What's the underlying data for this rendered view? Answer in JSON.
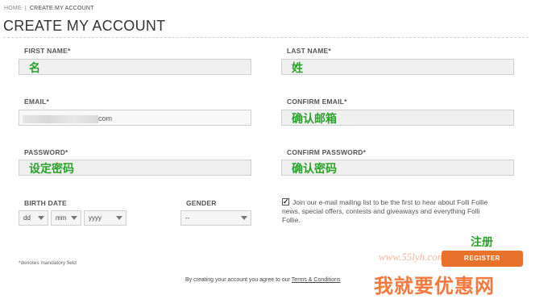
{
  "breadcrumb": {
    "home": "HOME",
    "separator": "|",
    "current": "CREATE MY ACCOUNT"
  },
  "page_title": "CREATE MY ACCOUNT",
  "fields": {
    "first_name": {
      "label": "FIRST NAME*",
      "value": "名"
    },
    "last_name": {
      "label": "LAST NAME*",
      "value": "姓"
    },
    "email": {
      "label": "EMAIL*",
      "value_suffix": "com"
    },
    "confirm_email": {
      "label": "CONFIRM EMAIL*",
      "value": "确认邮箱"
    },
    "password": {
      "label": "PASSWORD*",
      "value": "设定密码"
    },
    "confirm_password": {
      "label": "CONFIRM PASSWORD*",
      "value": "确认密码"
    }
  },
  "birth_date": {
    "label": "BIRTH DATE",
    "day": "dd",
    "month": "mm",
    "year": "yyyy"
  },
  "gender": {
    "label": "GENDER",
    "value": "--"
  },
  "mailing": {
    "checked": true,
    "text": "Join our e-mail mailing list to be the first to hear about Folli Follie news, special offers, contests and giveaways and everything Folli Follie."
  },
  "mandatory_note": "*denotes mandatory field",
  "register": {
    "annotation": "注册",
    "label": "REGISTER"
  },
  "terms": {
    "prefix": "By creating your account you agree to our",
    "link": "Terms & Conditions"
  },
  "watermark": {
    "url": "www.55lyh.com",
    "site": "我就要优惠网"
  },
  "colors": {
    "accent_orange": "#e8712b",
    "annotation_green": "#2aa12a"
  }
}
